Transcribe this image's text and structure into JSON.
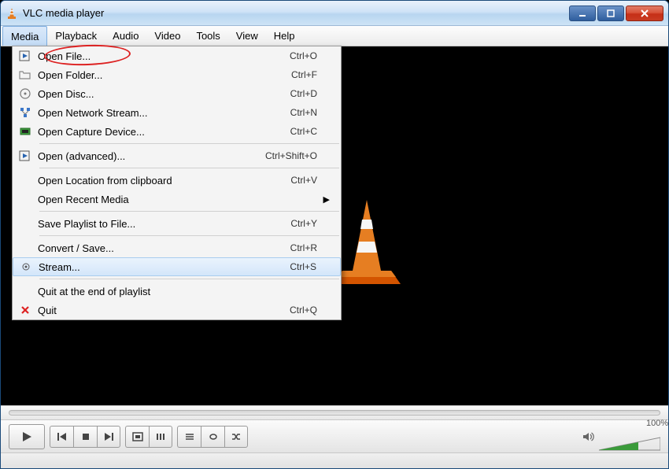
{
  "window": {
    "title": "VLC media player"
  },
  "menubar": {
    "items": [
      "Media",
      "Playback",
      "Audio",
      "Video",
      "Tools",
      "View",
      "Help"
    ],
    "active_index": 0
  },
  "media_menu": {
    "items": [
      {
        "label": "Open File...",
        "shortcut": "Ctrl+O",
        "icon": "file-play",
        "highlighted": true
      },
      {
        "label": "Open Folder...",
        "shortcut": "Ctrl+F",
        "icon": "folder"
      },
      {
        "label": "Open Disc...",
        "shortcut": "Ctrl+D",
        "icon": "disc"
      },
      {
        "label": "Open Network Stream...",
        "shortcut": "Ctrl+N",
        "icon": "network"
      },
      {
        "label": "Open Capture Device...",
        "shortcut": "Ctrl+C",
        "icon": "capture"
      },
      {
        "sep": true
      },
      {
        "label": "Open (advanced)...",
        "shortcut": "Ctrl+Shift+O",
        "icon": "file-play"
      },
      {
        "sep": true
      },
      {
        "label": "Open Location from clipboard",
        "shortcut": "Ctrl+V"
      },
      {
        "label": "Open Recent Media",
        "submenu": true
      },
      {
        "sep": true
      },
      {
        "label": "Save Playlist to File...",
        "shortcut": "Ctrl+Y"
      },
      {
        "sep": true
      },
      {
        "label": "Convert / Save...",
        "shortcut": "Ctrl+R"
      },
      {
        "label": "Stream...",
        "shortcut": "Ctrl+S",
        "icon": "stream",
        "hover": true
      },
      {
        "sep": true
      },
      {
        "label": "Quit at the end of playlist"
      },
      {
        "label": "Quit",
        "shortcut": "Ctrl+Q",
        "icon": "quit"
      }
    ]
  },
  "controls": {
    "volume_label": "100%"
  }
}
